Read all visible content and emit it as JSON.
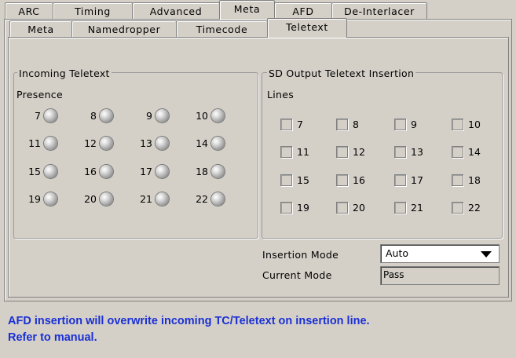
{
  "top_tabs": [
    "ARC",
    "Timing",
    "Advanced",
    "Meta",
    "AFD",
    "De-Interlacer"
  ],
  "active_top_tab": "Meta",
  "sub_tabs": [
    "Meta",
    "Namedropper",
    "Timecode",
    "Teletext"
  ],
  "active_sub_tab": "Teletext",
  "incoming": {
    "title": "Incoming Teletext",
    "presence_label": "Presence",
    "leds": [
      "7",
      "8",
      "9",
      "10",
      "11",
      "12",
      "13",
      "14",
      "15",
      "16",
      "17",
      "18",
      "19",
      "20",
      "21",
      "22"
    ]
  },
  "sd_output": {
    "title": "SD Output Teletext Insertion",
    "lines_label": "Lines",
    "checkboxes": [
      "7",
      "8",
      "9",
      "10",
      "11",
      "12",
      "13",
      "14",
      "15",
      "16",
      "17",
      "18",
      "19",
      "20",
      "21",
      "22"
    ]
  },
  "insertion_mode": {
    "label": "Insertion Mode",
    "value": "Auto"
  },
  "current_mode": {
    "label": "Current Mode",
    "value": "Pass"
  },
  "warning_lines": [
    "AFD insertion will overwrite incoming TC/Teletext on insertion line.",
    "Refer to manual."
  ]
}
